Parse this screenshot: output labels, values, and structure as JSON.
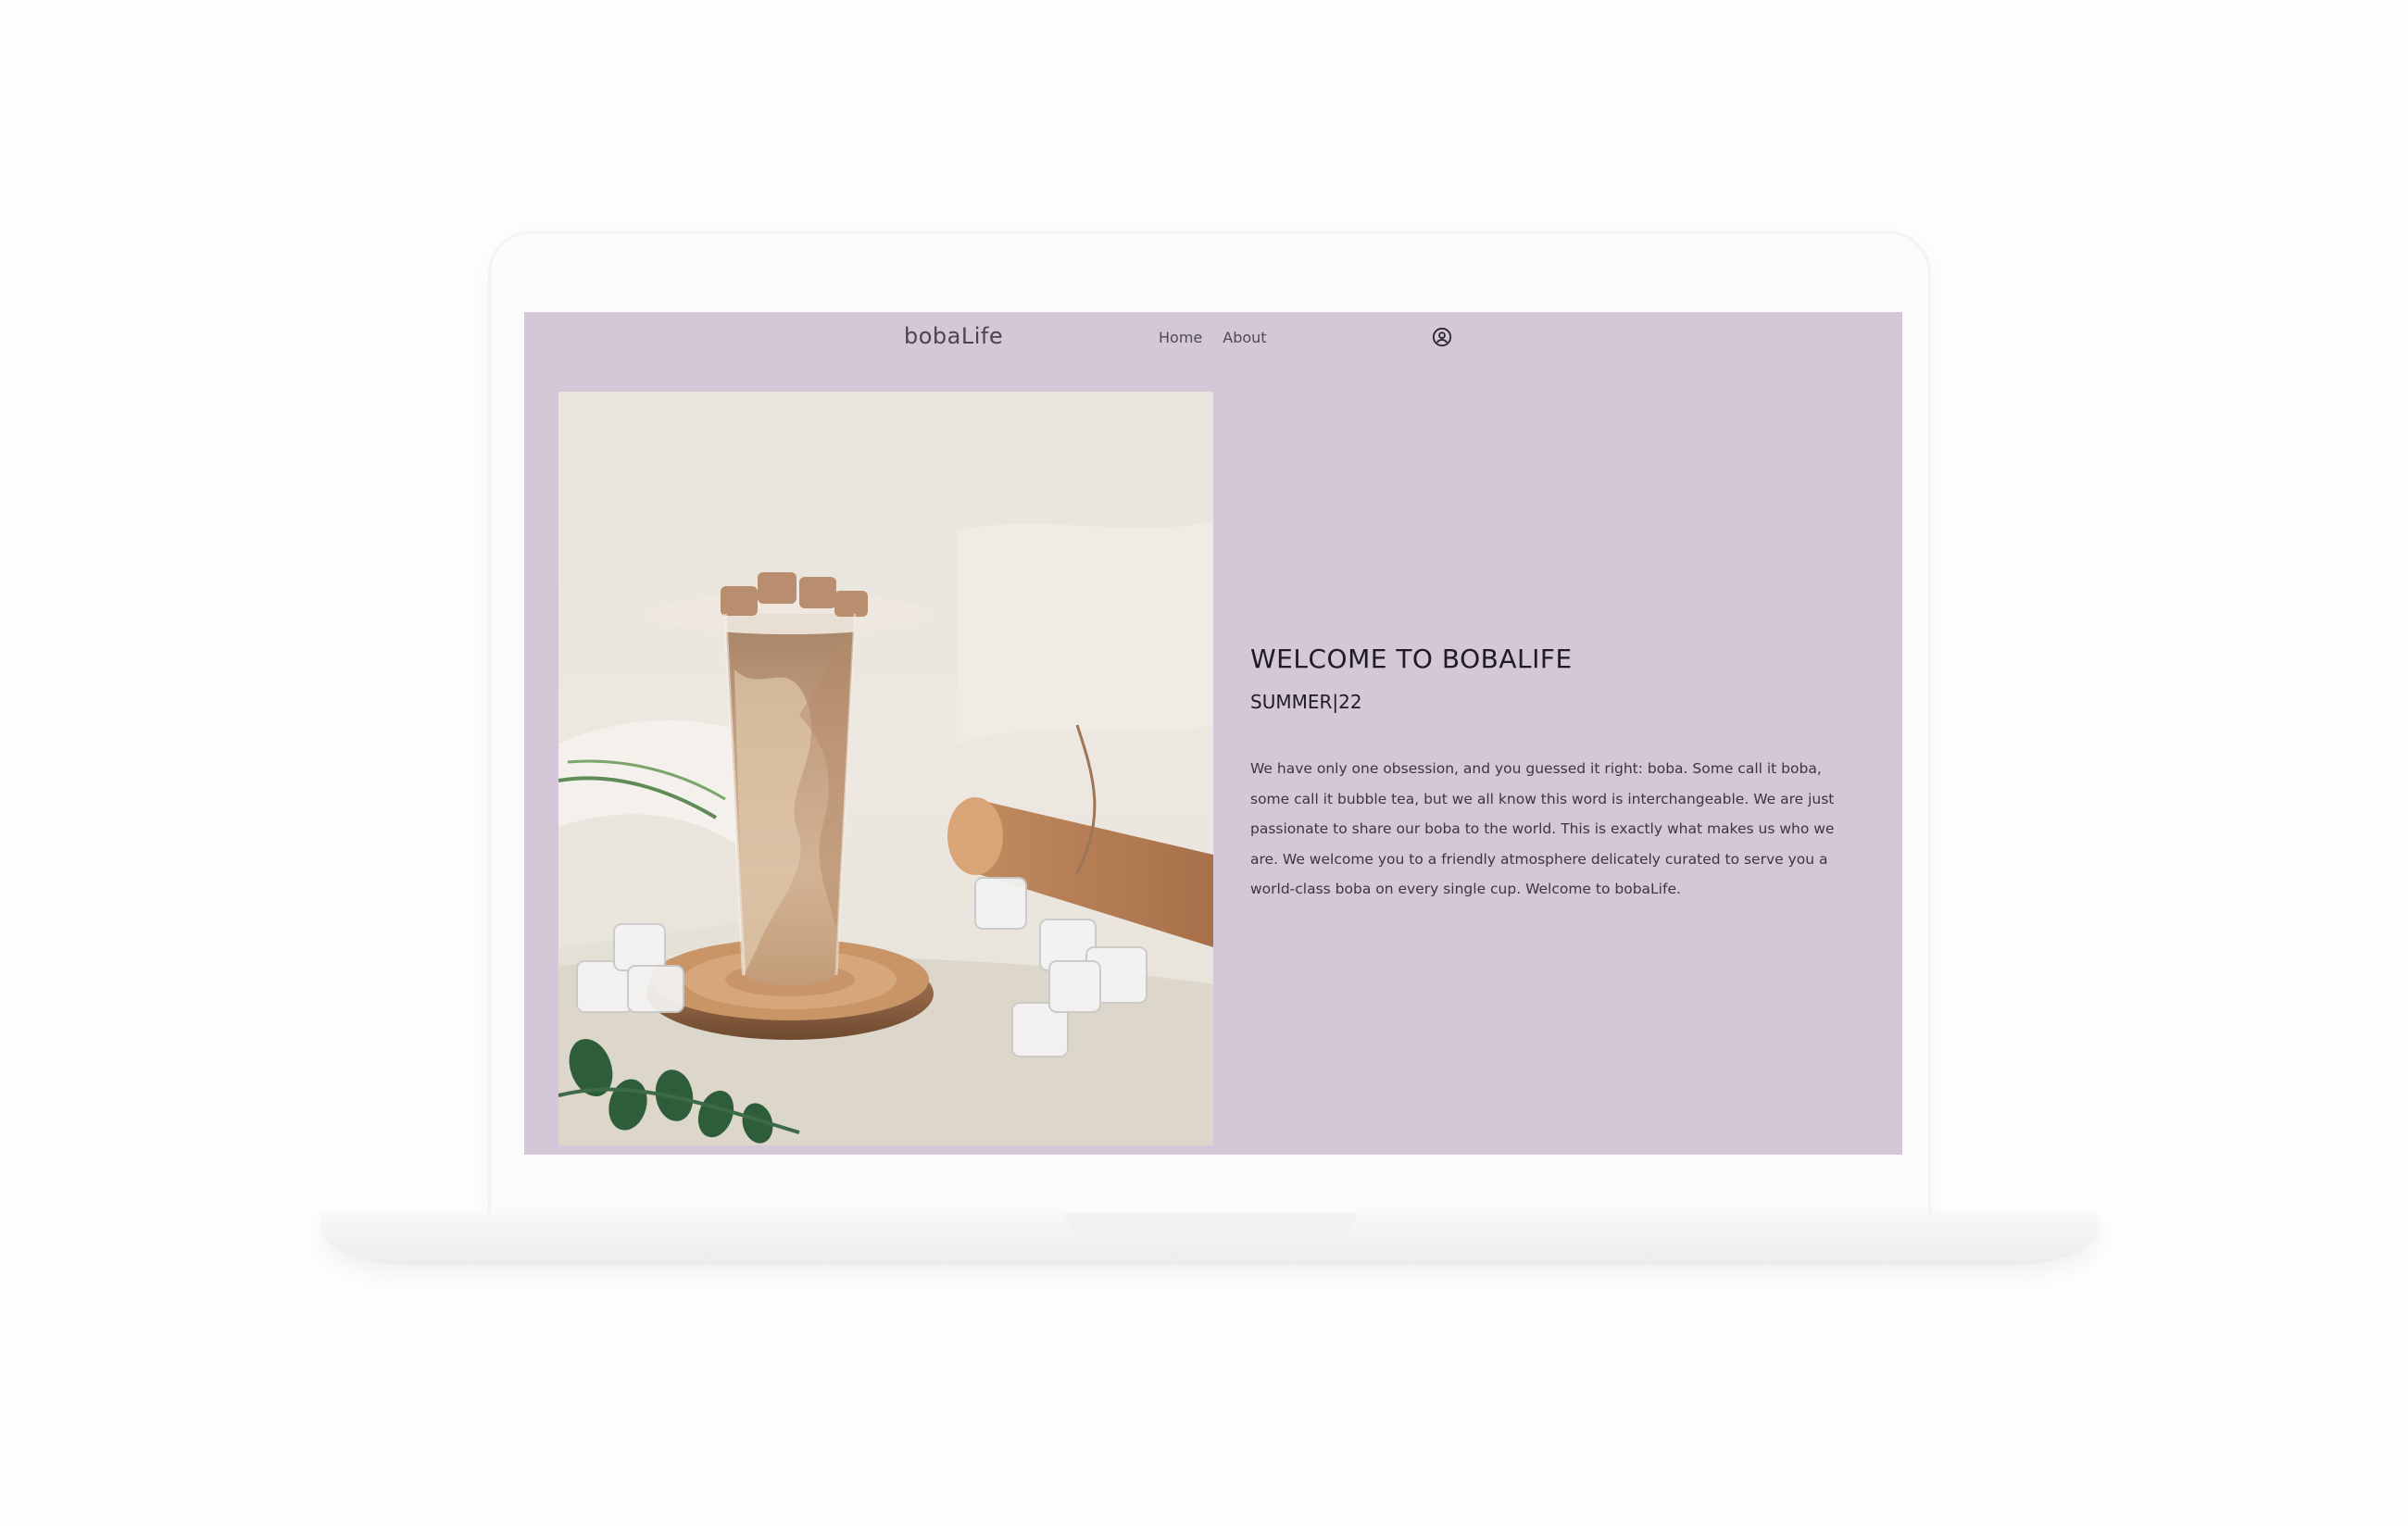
{
  "site": {
    "brand": "bobaLife",
    "nav": [
      {
        "label": "Home"
      },
      {
        "label": "About"
      }
    ],
    "account_icon": "user-circle-icon"
  },
  "hero": {
    "image_subject": "iced boba milk tea cup on wooden coaster with ice cubes",
    "title": "WELCOME TO BOBALIFE",
    "subtitle": "SUMMER|22",
    "body": "We have only one obsession, and you guessed it right: boba. Some call it boba, some call it bubble tea, but we all know this word is interchangeable. We are just passionate to share our boba to the world. This is exactly what makes us who we are. We welcome you to a friendly atmosphere delicately curated to serve you a world-class boba on every single cup. Welcome to bobaLife."
  },
  "colors": {
    "page_bg": "#d3c7d8",
    "text_dark": "#1e1b22",
    "mockup": "#fbfbfb"
  }
}
